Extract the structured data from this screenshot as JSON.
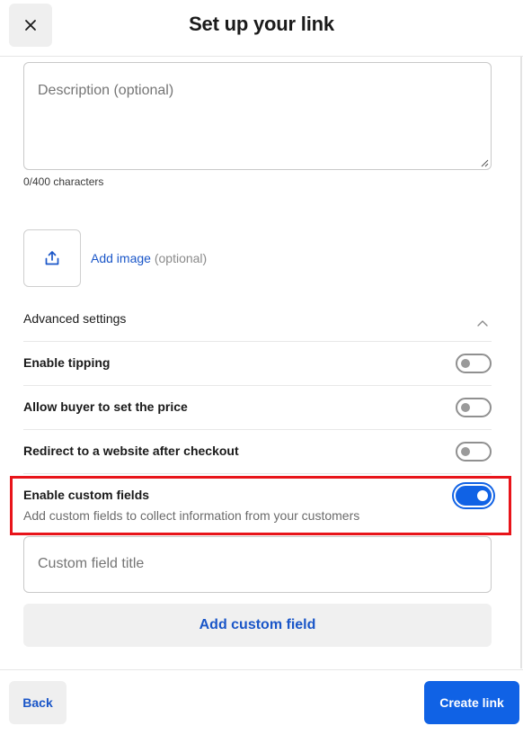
{
  "header": {
    "title": "Set up your link",
    "close_icon": "close-icon"
  },
  "description": {
    "placeholder": "Description (optional)",
    "value": "",
    "char_count": "0/400 characters"
  },
  "image": {
    "upload_icon": "upload-icon",
    "link_label": "Add image",
    "optional_label": "(optional)"
  },
  "advanced": {
    "title": "Advanced settings",
    "expanded": true,
    "settings": [
      {
        "label": "Enable tipping",
        "enabled": false
      },
      {
        "label": "Allow buyer to set the price",
        "enabled": false
      },
      {
        "label": "Redirect to a website after checkout",
        "enabled": false
      },
      {
        "label": "Enable custom fields",
        "description": "Add custom fields to collect information from your customers",
        "enabled": true
      }
    ]
  },
  "custom_field": {
    "placeholder": "Custom field title",
    "value": "",
    "add_button": "Add custom field"
  },
  "footer": {
    "back_label": "Back",
    "create_label": "Create link"
  },
  "colors": {
    "accent": "#1062e5",
    "link": "#1a56c8",
    "highlight": "#e8141a"
  }
}
